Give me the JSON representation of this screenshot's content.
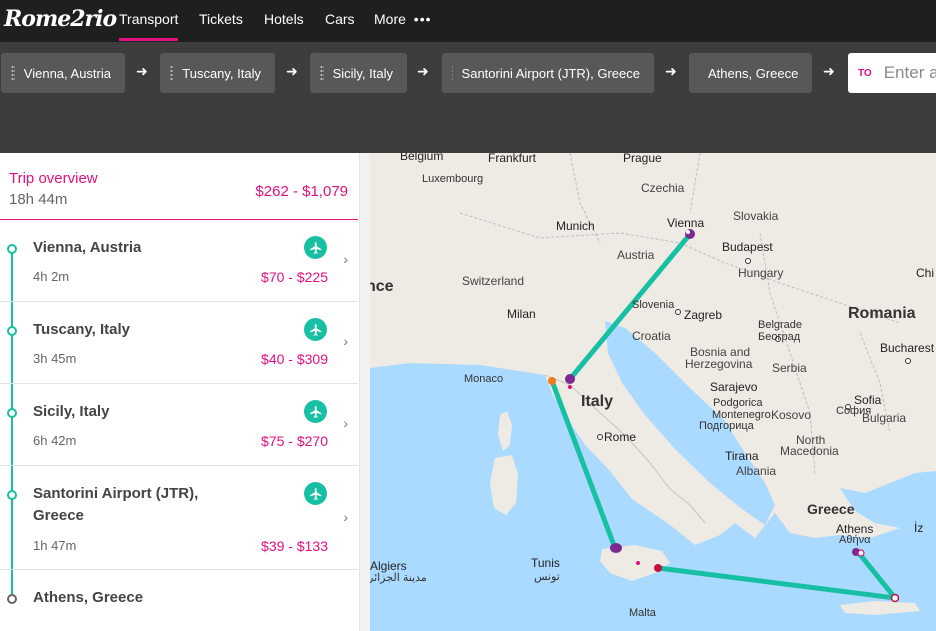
{
  "app": {
    "logo_text": "Rome2rio"
  },
  "nav": {
    "tabs": [
      {
        "label": "Transport",
        "active": true
      },
      {
        "label": "Tickets"
      },
      {
        "label": "Hotels"
      },
      {
        "label": "Cars"
      },
      {
        "label": "More"
      }
    ],
    "more_icon": "ellipsis-icon"
  },
  "route": {
    "stops": [
      "Vienna, Austria",
      "Tuscany, Italy",
      "Sicily, Italy",
      "Santorini Airport (JTR), Greece",
      "Athens, Greece"
    ],
    "to_label": "TO",
    "to_placeholder": "Enter a"
  },
  "trip": {
    "title": "Trip overview",
    "duration": "18h 44m",
    "price": "$262 - $1,079",
    "segments": [
      {
        "name": "Vienna, Austria",
        "duration": "4h 2m",
        "price": "$70 - $225",
        "mode_icon": "plane-icon"
      },
      {
        "name": "Tuscany, Italy",
        "duration": "3h 45m",
        "price": "$40 - $309",
        "mode_icon": "plane-icon"
      },
      {
        "name": "Sicily, Italy",
        "duration": "6h 42m",
        "price": "$75 - $270",
        "mode_icon": "plane-icon"
      },
      {
        "name": "Santorini Airport (JTR),",
        "name_line2": "Greece",
        "duration": "1h 47m",
        "price": "$39 - $133",
        "mode_icon": "plane-icon"
      }
    ],
    "destination": "Athens, Greece"
  },
  "map": {
    "labels": {
      "belgium": "Belgium",
      "frankfurt": "Frankfurt",
      "prague": "Prague",
      "luxembourg": "Luxembourg",
      "czechia": "Czechia",
      "vienna": "Vienna",
      "slovakia": "Slovakia",
      "munich": "Munich",
      "budapest": "Budapest",
      "austria": "Austria",
      "hungary": "Hungary",
      "switzerland": "Switzerland",
      "ce": "nce",
      "chi": "Chi",
      "romania": "Romania",
      "slovenia": "Slovenia",
      "zagreb": "Zagreb",
      "milan": "Milan",
      "croatia": "Croatia",
      "belgrade": "Belgrade",
      "belgrade_cyr": "Београд",
      "bucharest": "Bucharest",
      "bosnia": "Bosnia and",
      "herzegovina": "Herzegovina",
      "serbia": "Serbia",
      "monaco": "Monaco",
      "sarajevo": "Sarajevo",
      "italy": "Italy",
      "podgorica": "Podgorica",
      "montenegro": "Montenegro",
      "podgorica_cyr": "Подгорица",
      "kosovo": "Kosovo",
      "sofia": "Sofia",
      "sofia_cyr": "София",
      "bulgaria": "Bulgaria",
      "rome": "Rome",
      "north": "North",
      "macedonia": "Macedonia",
      "tirana": "Tirana",
      "albania": "Albania",
      "greece": "Greece",
      "athens": "Athens",
      "athens_gr": "Αθήνα",
      "algiers": "Algiers",
      "algiers_ar": "الجزائر",
      "algiers_ar2": "مدينة",
      "tunis": "Tunis",
      "tunis_ar": "تونس",
      "malta": "Malta",
      "iz": "İz"
    },
    "route_color": "#17c0a3",
    "marker_color": "#7b2a8f",
    "accent_color": "#e0107f",
    "orange_marker_color": "#ef7b1a"
  }
}
